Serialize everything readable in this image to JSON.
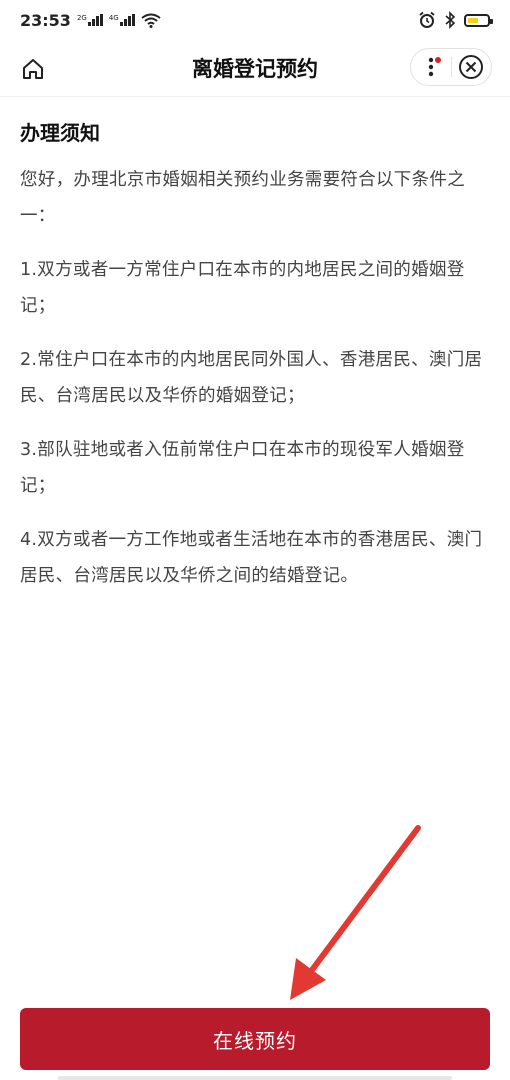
{
  "status_bar": {
    "time": "23:53",
    "net1": "2G",
    "net2": "4G",
    "battery_level": 0.55
  },
  "nav": {
    "title": "离婚登记预约"
  },
  "content": {
    "section_title": "办理须知",
    "paragraphs": [
      "您好，办理北京市婚姻相关预约业务需要符合以下条件之一：",
      "1.双方或者一方常住户口在本市的内地居民之间的婚姻登记；",
      "2.常住户口在本市的内地居民同外国人、香港居民、澳门居民、台湾居民以及华侨的婚姻登记；",
      "3.部队驻地或者入伍前常住户口在本市的现役军人婚姻登记；",
      "4.双方或者一方工作地或者生活地在本市的香港居民、澳门居民、台湾居民以及华侨之间的结婚登记。"
    ]
  },
  "footer": {
    "button_label": "在线预约"
  },
  "colors": {
    "primary": "#b81b2b",
    "annotation_arrow": "#e23a32",
    "badge": "#e02020"
  },
  "icons": {
    "home": "home-icon",
    "more": "more-vertical-icon",
    "close": "close-circle-icon",
    "alarm": "alarm-icon",
    "bluetooth": "bluetooth-icon",
    "wifi": "wifi-icon"
  }
}
